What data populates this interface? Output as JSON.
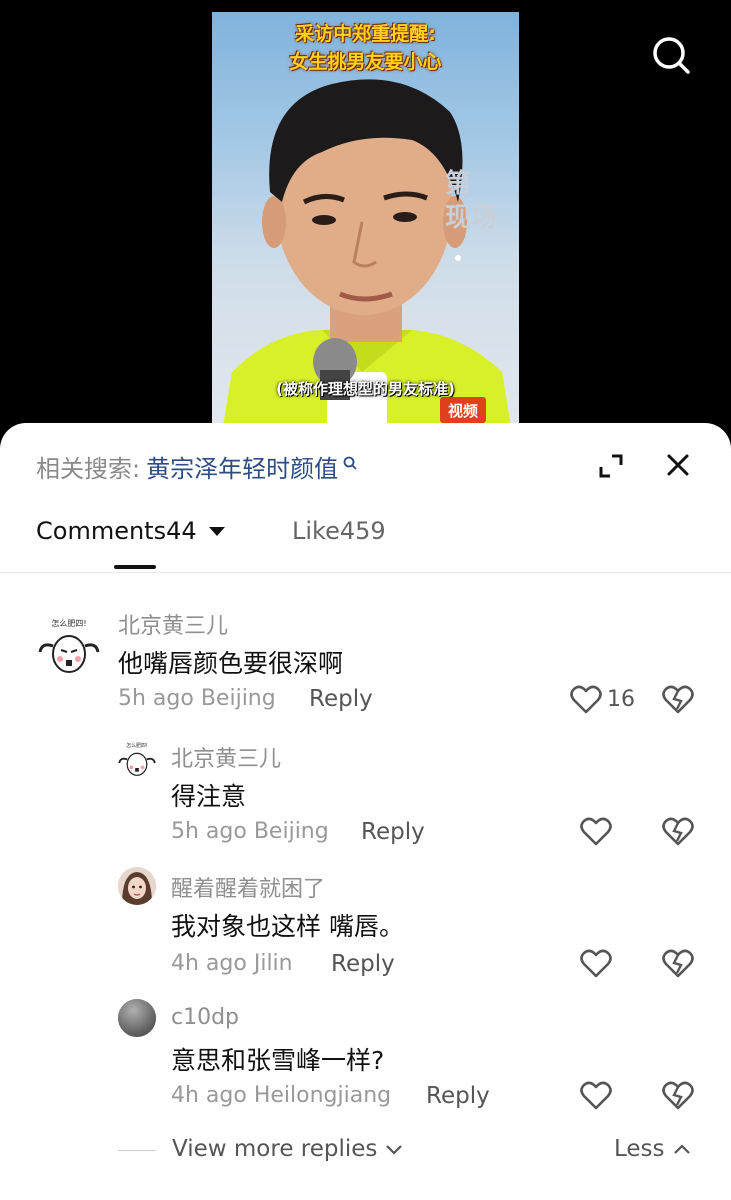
{
  "video": {
    "caption_top_line1": "采访中郑重提醒:",
    "caption_top_line2": "女生挑男友要小心",
    "background_text": "第\n现场",
    "subtitle": "(被称作理想型的男友标准)",
    "mic_brand": "视频"
  },
  "header": {
    "related_label": "相关搜索:",
    "related_keyword": "黄宗泽年轻时颜值"
  },
  "tabs": {
    "comments_label": "Comments44",
    "like_label": "Like459"
  },
  "comments": [
    {
      "username": "北京黄三儿",
      "text": "他嘴唇颜色要很深啊",
      "time": "5h ago",
      "location": "Beijing",
      "reply_label": "Reply",
      "likes": "16",
      "avatar_caption": "怎么肥四!"
    },
    {
      "username": "北京黄三儿",
      "text": "得注意",
      "time": "5h ago",
      "location": "Beijing",
      "reply_label": "Reply",
      "avatar_caption": "怎么肥四!"
    },
    {
      "username": "醒着醒着就困了",
      "text": "我对象也这样 嘴唇。",
      "time": "4h ago",
      "location": "Jilin",
      "reply_label": "Reply"
    },
    {
      "username": "c10dp",
      "text": "意思和张雪峰一样?",
      "time": "4h ago",
      "location": "Heilongjiang",
      "reply_label": "Reply"
    }
  ],
  "footer": {
    "view_more_label": "View more replies",
    "less_label": "Less"
  },
  "colors": {
    "caption_yellow": "#ffd21c",
    "keyword_blue": "#2c4c82",
    "shirt_yellow": "#d7f02a"
  }
}
